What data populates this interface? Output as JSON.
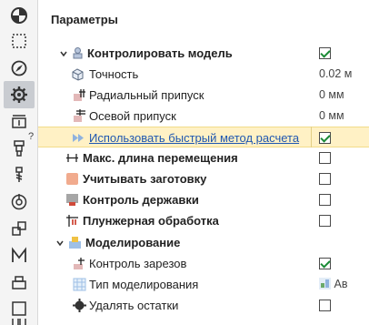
{
  "panel": {
    "title": "Параметры"
  },
  "help_mark": "?",
  "rows": [
    {
      "label": "Контролировать модель",
      "checked": true,
      "icon": "model-icon"
    },
    {
      "label": "Точность",
      "value": "0.02 м",
      "icon": "accuracy-icon"
    },
    {
      "label": "Радиальный припуск",
      "value": "0 мм",
      "icon": "radial-allowance-icon"
    },
    {
      "label": "Осевой припуск",
      "value": "0 мм",
      "icon": "axial-allowance-icon"
    },
    {
      "label": "Использовать быстрый метод расчета",
      "checked": true,
      "icon": "fast-forward-icon"
    },
    {
      "label": "Макс. длина перемещения",
      "checked": false,
      "icon": "move-length-icon"
    },
    {
      "label": "Учитывать заготовку",
      "checked": false,
      "icon": "stock-icon"
    },
    {
      "label": "Контроль державки",
      "checked": false,
      "icon": "holder-icon"
    },
    {
      "label": "Плунжерная обработка",
      "checked": false,
      "icon": "plunge-icon"
    },
    {
      "label": "Моделирование",
      "icon": "simulation-icon"
    },
    {
      "label": "Контроль зарезов",
      "checked": true,
      "icon": "gouge-icon"
    },
    {
      "label": "Тип моделирования",
      "value": "Ав",
      "icon": "sim-type-icon"
    },
    {
      "label": "Удалять остатки",
      "checked": false,
      "icon": "remove-icon"
    }
  ],
  "colors": {
    "accent": "#1f57b0",
    "check": "#1a8a35",
    "selection": "#fff1c5",
    "toolbar_bg": "#f4f4f4"
  },
  "toolbar_icons": [
    "pie-chart-icon",
    "dashed-rect-icon",
    "compass-icon",
    "gear-icon",
    "stack-icon",
    "tool-icon",
    "spindle-icon",
    "target-icon",
    "blocks-icon",
    "m-icon",
    "layers-icon",
    "square-icon",
    "columns-icon"
  ]
}
